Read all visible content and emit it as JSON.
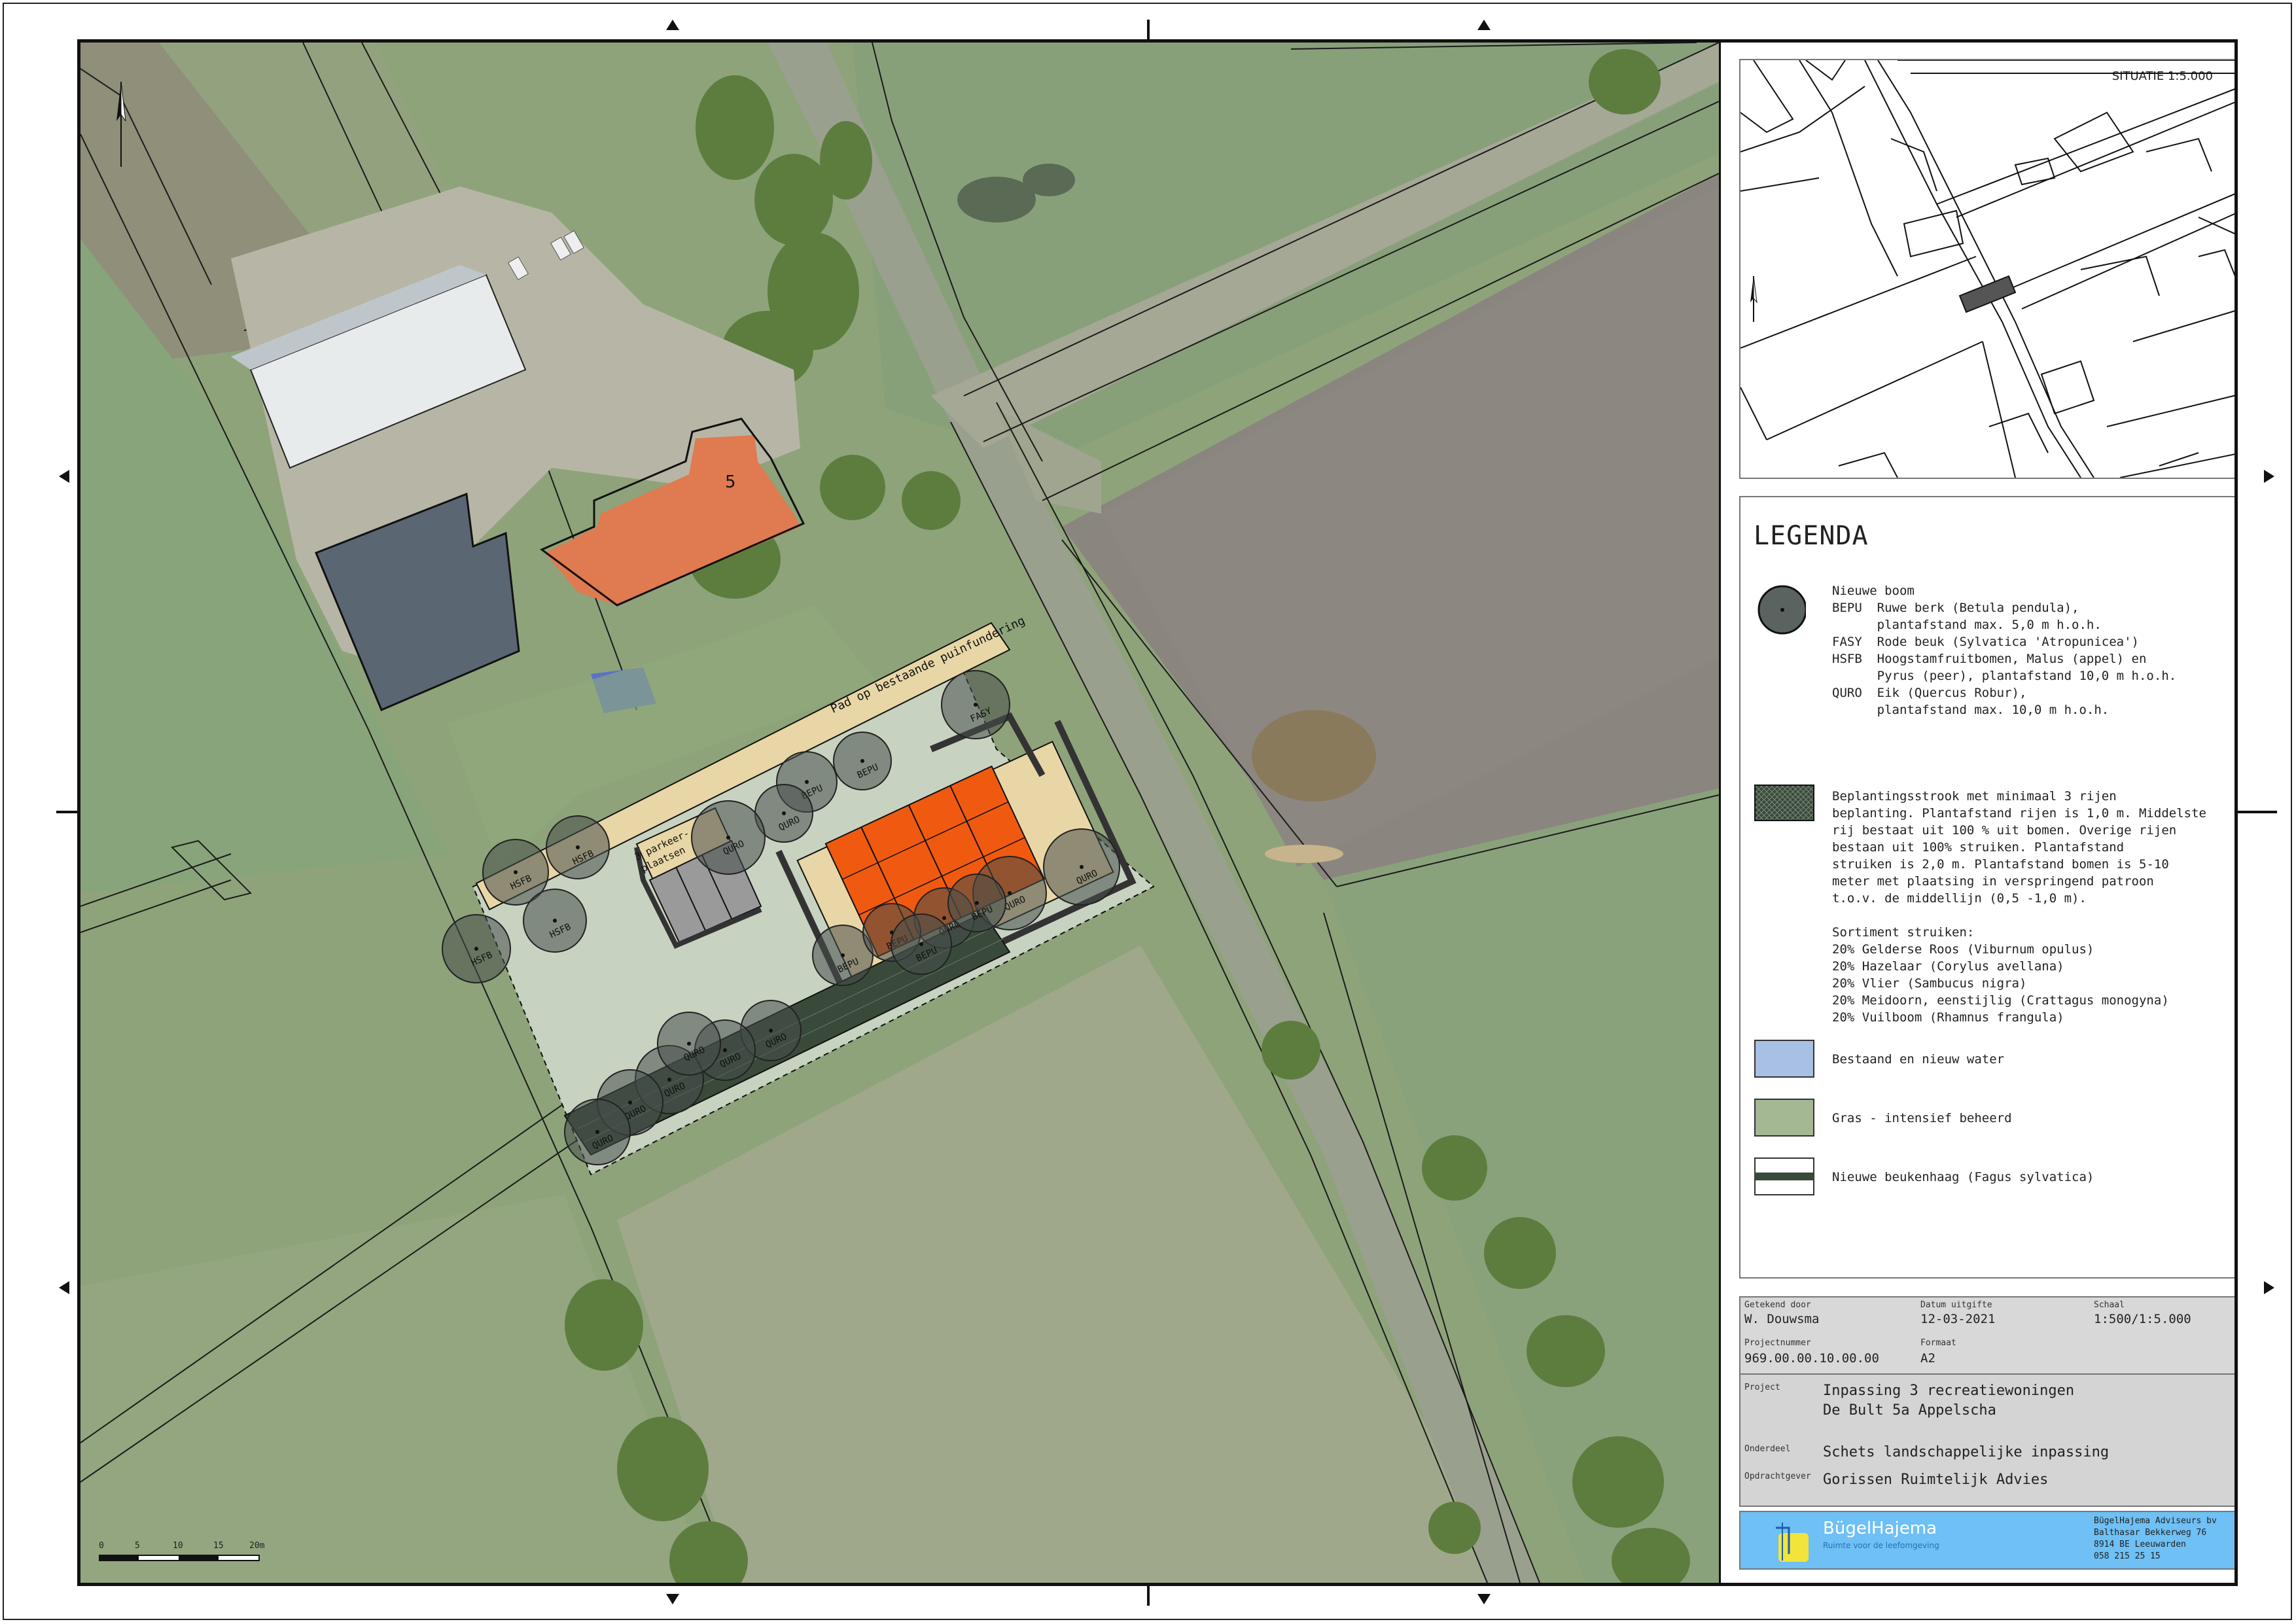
{
  "map": {
    "house_number": "5",
    "path_label": "Pad op bestaande puinfundering",
    "parking_label_1": "3 parkeer-",
    "parking_label_2": "plaatsen",
    "trees": [
      {
        "code": "FASY"
      },
      {
        "code": "BEPU"
      },
      {
        "code": "BEPU"
      },
      {
        "code": "QURO"
      },
      {
        "code": "QURO"
      },
      {
        "code": "HSFB"
      },
      {
        "code": "HSFB"
      },
      {
        "code": "HSFB"
      },
      {
        "code": "HSFB"
      },
      {
        "code": "QURO"
      },
      {
        "code": "QURO"
      },
      {
        "code": "QURO"
      },
      {
        "code": "QURO"
      },
      {
        "code": "QURO"
      },
      {
        "code": "QURO"
      },
      {
        "code": "BEPU"
      },
      {
        "code": "BEPU"
      },
      {
        "code": "BEPU"
      },
      {
        "code": "QURO"
      },
      {
        "code": "BEPU"
      },
      {
        "code": "QURO"
      },
      {
        "code": "QURO"
      }
    ],
    "scalebar_labels": [
      "0",
      "5",
      "10",
      "15",
      "20m"
    ],
    "colors": {
      "grass": "#8ea37a",
      "field": "#8b8580",
      "house_roof": "#e07a50",
      "new_building": "#f05a10",
      "beige": "#e8d6a6",
      "plot": "#c8d2c0"
    }
  },
  "situatie": {
    "title": "SITUATIE 1:5.000"
  },
  "legend": {
    "title": "LEGENDA",
    "tree_text": "Nieuwe boom\nBEPU  Ruwe berk (Betula pendula),\n      plantafstand max. 5,0 m h.o.h.\nFASY  Rode beuk (Sylvatica 'Atropunicea')\nHSFB  Hoogstamfruitbomen, Malus (appel) en\n      Pyrus (peer), plantafstand 10,0 m h.o.h.\nQURO  Eik (Quercus Robur),\n      plantafstand max. 10,0 m h.o.h.",
    "strip_text": "Beplantingsstrook met minimaal 3 rijen\nbeplanting. Plantafstand rijen is 1,0 m. Middelste\nrij bestaat uit 100 % uit bomen. Overige rijen\nbestaan uit 100% struiken. Plantafstand\nstruiken is 2,0 m. Plantafstand bomen is 5-10\nmeter met plaatsing in verspringend patroon\nt.o.v. de middellijn (0,5 -1,0 m).\n\nSortiment struiken:\n20% Gelderse Roos (Viburnum opulus)\n20% Hazelaar (Corylus avellana)\n20% Vlier (Sambucus nigra)\n20% Meidoorn, eenstijlig (Crattagus monogyna)\n20% Vuilboom (Rhamnus frangula)",
    "water_text": "Bestaand en nieuw water",
    "grass_text": "Gras - intensief beheerd",
    "hedge_text": "Nieuwe beukenhaag (Fagus sylvatica)",
    "colors": {
      "water": "#a8c0e4",
      "grass": "#a3b893",
      "strip": "#3a4a3a"
    }
  },
  "titleblock": {
    "drawn_by_label": "Getekend door",
    "drawn_by": "W. Douwsma",
    "date_label": "Datum uitgifte",
    "date": "12-03-2021",
    "scale_label": "Schaal",
    "scale": "1:500/1:5.000",
    "projectnr_label": "Projectnummer",
    "projectnr": "969.00.00.10.00.00",
    "format_label": "Formaat",
    "format": "A2",
    "project_label": "Project",
    "project_line1": "Inpassing 3 recreatiewoningen",
    "project_line2": "De Bult 5a Appelscha",
    "part_label": "Onderdeel",
    "part": "Schets landschappelijke inpassing",
    "client_label": "Opdrachtgever",
    "client": "Gorissen Ruimtelijk Advies"
  },
  "company": {
    "name": "BügelHajema",
    "tagline": "Ruimte voor de leefomgeving",
    "address_1": "BügelHajema Adviseurs bv",
    "address_2": "Balthasar Bekkerweg 76",
    "address_3": "8914 BE Leeuwarden",
    "address_4": "058 215 25 15",
    "colors": {
      "bar": "#6ec0f5",
      "logo": "#f2e43a"
    }
  }
}
